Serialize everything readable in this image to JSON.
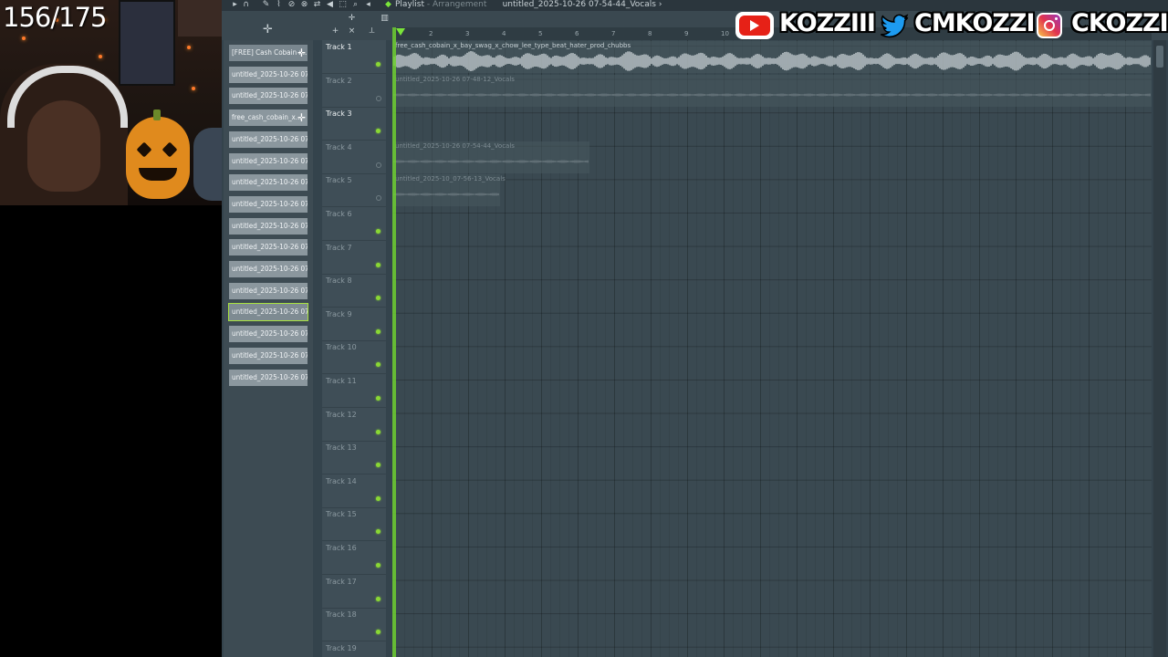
{
  "overlay": {
    "counter": "156/175",
    "socials": [
      {
        "platform": "youtube-icon",
        "handle": "KOZZIII"
      },
      {
        "platform": "twitter-icon",
        "handle": "CMKOZZI"
      },
      {
        "platform": "instagram-icon",
        "handle": "CKOZZI"
      }
    ]
  },
  "window": {
    "title": "Playlist",
    "subtitle": "Arrangement",
    "pattern": "untitled_2025-10-26 07-54-44_Vocals"
  },
  "ruler": [
    "2",
    "3",
    "4",
    "5",
    "6",
    "7",
    "8",
    "9",
    "10"
  ],
  "browser": {
    "items": [
      "[FREE] Cash Cobain x...",
      "untitled_2025-10-26 07-...",
      "untitled_2025-10-26 07-...",
      "free_cash_cobain_x...",
      "untitled_2025-10-26 07-...",
      "untitled_2025-10-26 07-...",
      "untitled_2025-10-26 07-...",
      "untitled_2025-10-26 07-...",
      "untitled_2025-10-26 07-...",
      "untitled_2025-10-26 07-...",
      "untitled_2025-10-26 07-...",
      "untitled_2025-10-26 07-...",
      "untitled_2025-10-26 07-...",
      "untitled_2025-10-26 07-...",
      "untitled_2025-10-26 07-...",
      "untitled_2025-10-26 07-..."
    ],
    "selected_index": 12
  },
  "tracks": [
    {
      "name": "Track 1",
      "active": true,
      "led": "on"
    },
    {
      "name": "Track 2",
      "active": false,
      "led": "off"
    },
    {
      "name": "Track 3",
      "active": true,
      "led": "on"
    },
    {
      "name": "Track 4",
      "active": false,
      "led": "off"
    },
    {
      "name": "Track 5",
      "active": false,
      "led": "off"
    },
    {
      "name": "Track 6",
      "active": false,
      "led": "on"
    },
    {
      "name": "Track 7",
      "active": false,
      "led": "on"
    },
    {
      "name": "Track 8",
      "active": false,
      "led": "on"
    },
    {
      "name": "Track 9",
      "active": false,
      "led": "on"
    },
    {
      "name": "Track 10",
      "active": false,
      "led": "on"
    },
    {
      "name": "Track 11",
      "active": false,
      "led": "on"
    },
    {
      "name": "Track 12",
      "active": false,
      "led": "on"
    },
    {
      "name": "Track 13",
      "active": false,
      "led": "on"
    },
    {
      "name": "Track 14",
      "active": false,
      "led": "on"
    },
    {
      "name": "Track 15",
      "active": false,
      "led": "on"
    },
    {
      "name": "Track 16",
      "active": false,
      "led": "on"
    },
    {
      "name": "Track 17",
      "active": false,
      "led": "on"
    },
    {
      "name": "Track 18",
      "active": false,
      "led": "on"
    },
    {
      "name": "Track 19",
      "active": false,
      "led": "on"
    }
  ],
  "clips": [
    {
      "label": "free_cash_cobain_x_bay_swag_x_chow_lee_type_beat_hater_prod_chubbs",
      "track": 1,
      "dim": false
    },
    {
      "label": "untitled_2025-10-26 07-48-12_Vocals",
      "track": 2,
      "dim": true
    },
    {
      "label": "untitled_2025-10-26 07-54-44_Vocals",
      "track": 4,
      "dim": true
    },
    {
      "label": "untitled_2025-10_07-56-13_Vocals",
      "track": 5,
      "dim": true
    }
  ]
}
